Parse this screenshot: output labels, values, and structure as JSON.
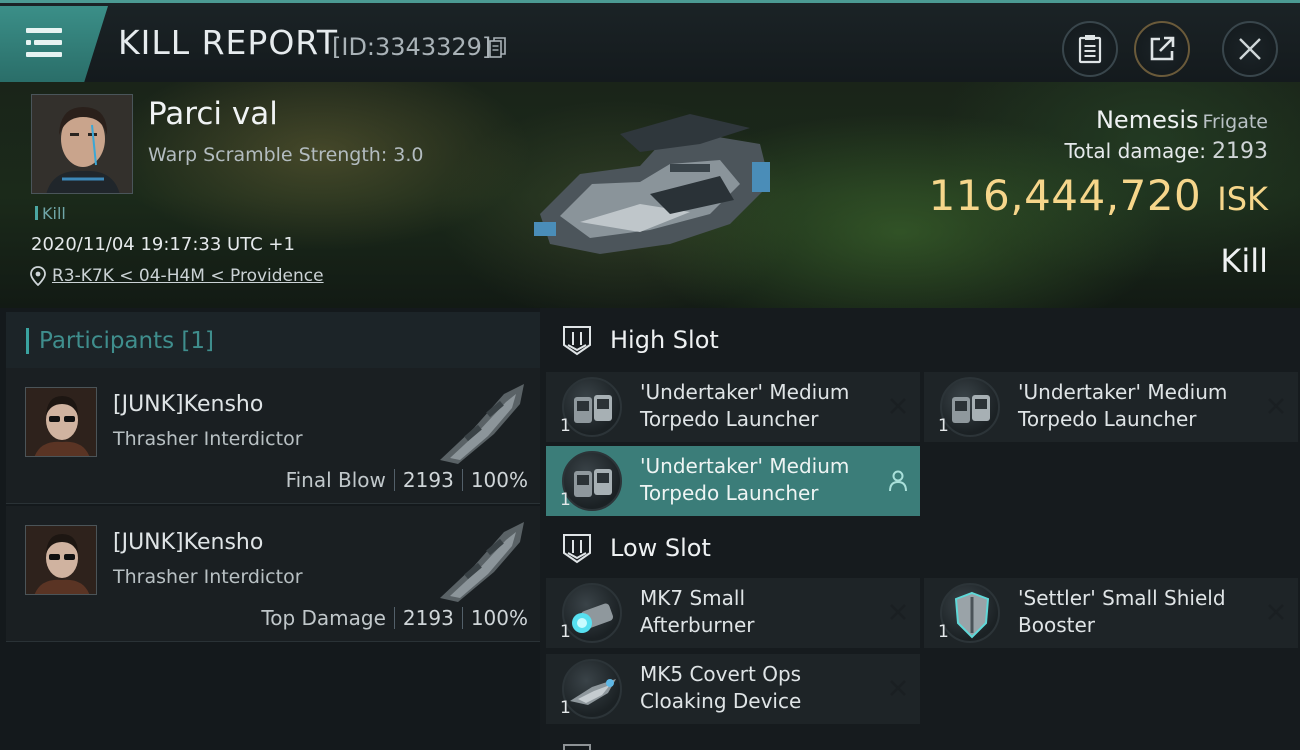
{
  "header": {
    "title": "KILL REPORT",
    "report_id": "[ID:3343329]"
  },
  "victim": {
    "pilot_name": "Parci val",
    "warp_scramble": "Warp Scramble Strength: 3.0",
    "tag": "Kill",
    "datetime": "2020/11/04 19:17:33 UTC +1",
    "location": "R3-K7K < 04-H4M < Providence",
    "ship_name": "Nemesis",
    "ship_class": "Frigate",
    "total_damage_label": "Total damage:",
    "total_damage": "2193",
    "isk_value": "116,444,720",
    "isk_unit": "ISK",
    "result": "Kill"
  },
  "participants": {
    "header": "Participants [1]",
    "rows": [
      {
        "name": "[JUNK]Kensho",
        "ship": "Thrasher Interdictor",
        "label": "Final Blow",
        "damage": "2193",
        "percent": "100%"
      },
      {
        "name": "[JUNK]Kensho",
        "ship": "Thrasher Interdictor",
        "label": "Top Damage",
        "damage": "2193",
        "percent": "100%"
      }
    ]
  },
  "fittings": {
    "high_slot": {
      "label": "High Slot",
      "items": [
        {
          "qty": "1",
          "name_line1": "'Undertaker' Medium",
          "name_line2": "Torpedo Launcher",
          "status": "destroyed"
        },
        {
          "qty": "1",
          "name_line1": "'Undertaker' Medium",
          "name_line2": "Torpedo Launcher",
          "status": "destroyed"
        },
        {
          "qty": "1",
          "name_line1": "'Undertaker' Medium",
          "name_line2": "Torpedo Launcher",
          "status": "dropped"
        }
      ]
    },
    "low_slot": {
      "label": "Low Slot",
      "items": [
        {
          "qty": "1",
          "name_line1": "MK7 Small",
          "name_line2": "Afterburner",
          "status": "destroyed"
        },
        {
          "qty": "1",
          "name_line1": "'Settler' Small Shield",
          "name_line2": "Booster",
          "status": "destroyed"
        },
        {
          "qty": "1",
          "name_line1": "MK5 Covert Ops",
          "name_line2": "Cloaking Device",
          "status": "destroyed"
        }
      ]
    }
  },
  "colors": {
    "accent_teal": "#3b7d79",
    "isk_gold": "#f6d68b"
  },
  "icons": [
    "menu-icon",
    "copy-icon",
    "clipboard-icon",
    "share-icon",
    "close-icon",
    "location-pin-icon",
    "slot-icon",
    "remove-icon",
    "user-icon"
  ]
}
